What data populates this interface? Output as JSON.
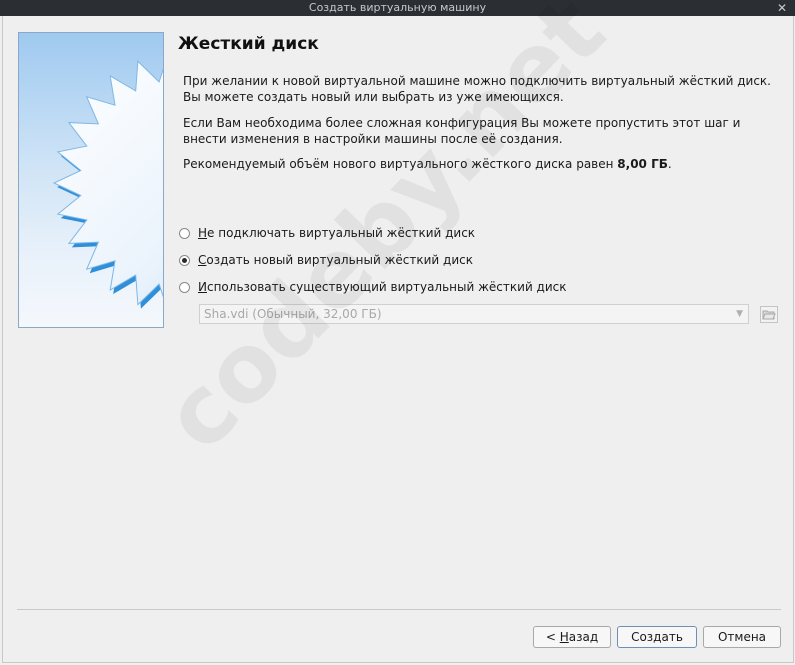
{
  "window": {
    "title": "Создать виртуальную машину",
    "close_glyph": "✕"
  },
  "page": {
    "title": "Жесткий диск",
    "paragraph1": "При желании к новой виртуальной машине можно подключить виртуальный жёсткий диск. Вы можете создать новый или выбрать из уже имеющихся.",
    "paragraph2": "Если Вам необходима более сложная конфигурация Вы можете пропустить этот шаг и внести изменения в настройки машины после её создания.",
    "recommend_prefix": "Рекомендуемый объём нового виртуального жёсткого диска равен ",
    "recommend_size": "8,00 ГБ",
    "recommend_suffix": "."
  },
  "options": [
    {
      "mnemonic": "Н",
      "label_rest": "е подключать виртуальный жёсткий диск",
      "checked": false
    },
    {
      "mnemonic": "С",
      "label_rest": "оздать новый виртуальный жёсткий диск",
      "checked": true
    },
    {
      "mnemonic": "И",
      "label_rest": "спользовать существующий виртуальный жёсткий диск",
      "checked": false
    }
  ],
  "existing_disk": {
    "value": "Sha.vdi (Обычный, 32,00 ГБ)",
    "enabled": false
  },
  "watermark": "codeby.net",
  "buttons": {
    "back_prefix": "< ",
    "back_mnemonic": "Н",
    "back_rest": "азад",
    "create": "Создать",
    "cancel": "Отмена"
  },
  "icons": {
    "wizard": "wizard-star-graphic",
    "folder": "folder-open-icon",
    "dropdown": "chevron-down-icon",
    "close": "close-icon"
  }
}
